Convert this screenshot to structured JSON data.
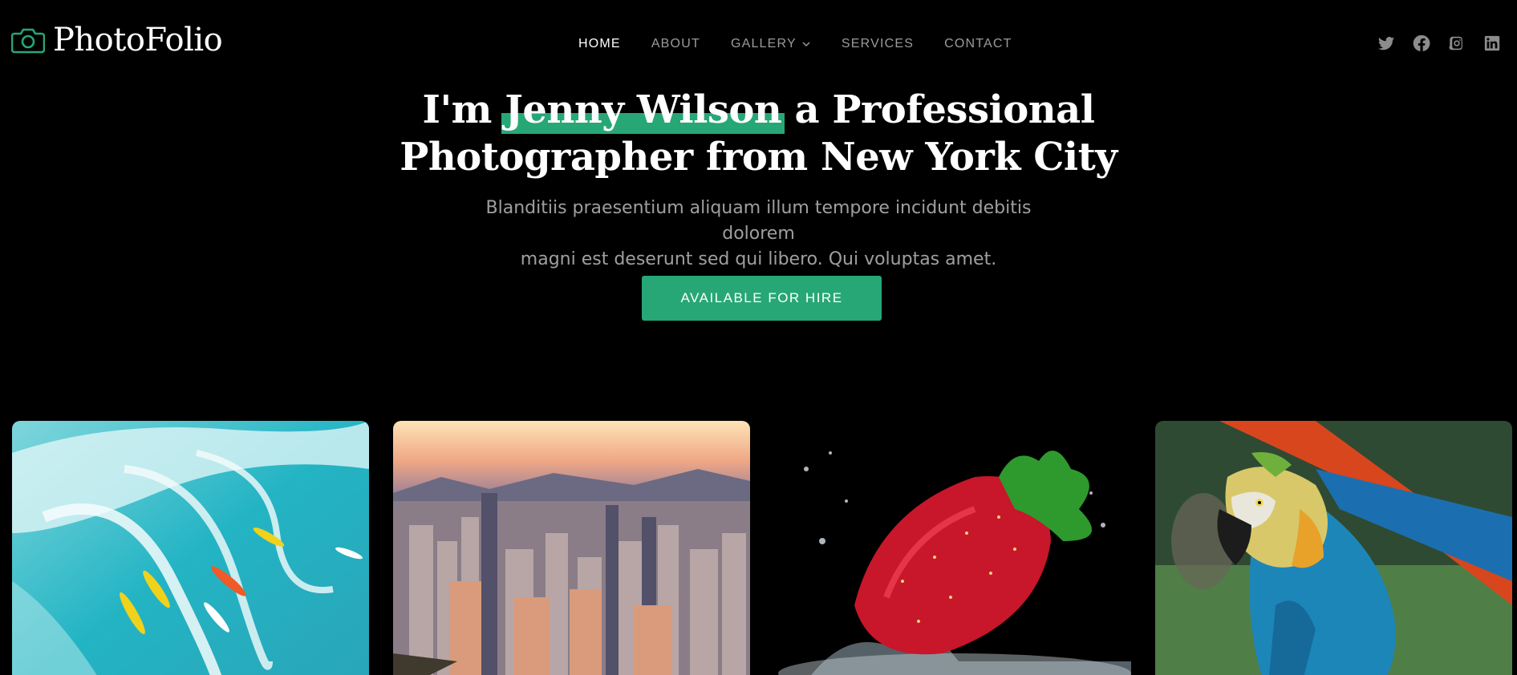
{
  "brand": {
    "name": "PhotoFolio",
    "icon": "camera-icon",
    "accent": "#27a776"
  },
  "nav": {
    "items": [
      {
        "label": "HOME",
        "active": true
      },
      {
        "label": "ABOUT",
        "active": false
      },
      {
        "label": "GALLERY",
        "active": false,
        "has_dropdown": true
      },
      {
        "label": "SERVICES",
        "active": false
      },
      {
        "label": "CONTACT",
        "active": false
      }
    ]
  },
  "social": [
    "twitter-icon",
    "facebook-icon",
    "instagram-icon",
    "linkedin-icon"
  ],
  "hero": {
    "title_prefix": "I'm",
    "title_name": "Jenny Wilson",
    "title_suffix": "a Professional",
    "title_line2": "Photographer from New York City",
    "description_line1": "Blanditiis praesentium aliquam illum tempore incidunt debitis dolorem",
    "description_line2": "magni est deserunt sed qui libero. Qui voluptas amet.",
    "cta_label": "AVAILABLE FOR HIRE"
  },
  "gallery": [
    {
      "subject": "surfers-on-wave"
    },
    {
      "subject": "city-skyline-sunset"
    },
    {
      "subject": "strawberry-splash"
    },
    {
      "subject": "macaw-parrot"
    }
  ]
}
